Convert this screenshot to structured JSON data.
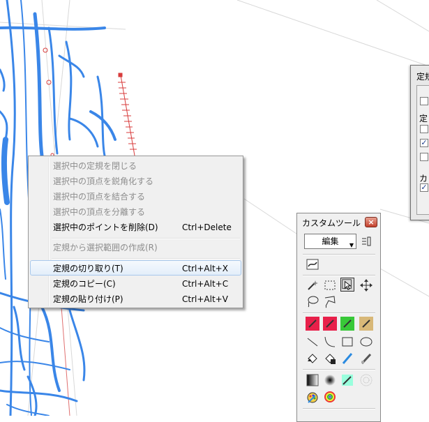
{
  "context_menu": {
    "items": [
      {
        "label": "選択中の定規を閉じる",
        "shortcut": "",
        "enabled": false
      },
      {
        "label": "選択中の頂点を鋭角化する",
        "shortcut": "",
        "enabled": false
      },
      {
        "label": "選択中の頂点を結合する",
        "shortcut": "",
        "enabled": false
      },
      {
        "label": "選択中の頂点を分離する",
        "shortcut": "",
        "enabled": false
      },
      {
        "label": "選択中のポイントを削除(D)",
        "shortcut": "Ctrl+Delete",
        "enabled": true
      },
      {
        "label": "定規から選択範囲の作成(R)",
        "shortcut": "",
        "enabled": false
      },
      {
        "label": "定規の切り取り(T)",
        "shortcut": "Ctrl+Alt+X",
        "enabled": true,
        "hover": true
      },
      {
        "label": "定規のコピー(C)",
        "shortcut": "Ctrl+Alt+C",
        "enabled": true
      },
      {
        "label": "定規の貼り付け(P)",
        "shortcut": "Ctrl+Alt+V",
        "enabled": true
      }
    ]
  },
  "tool_panel": {
    "title": "カスタムツール",
    "close_label": "×",
    "dropdown_value": "編集",
    "tools": [
      {
        "icon": "ruler-edit-icon"
      },
      {
        "icon": "magic-wand-icon"
      },
      {
        "icon": "rect-select-icon"
      },
      {
        "icon": "pointer-select-icon",
        "selected": true
      },
      {
        "icon": "move-icon"
      },
      {
        "icon": "lasso-icon"
      },
      {
        "icon": "polygon-lasso-icon"
      },
      {
        "icon": "pen-red-icon"
      },
      {
        "icon": "pen-magenta-icon"
      },
      {
        "icon": "pen-green-icon"
      },
      {
        "icon": "pen-tan-icon"
      },
      {
        "icon": "line-icon"
      },
      {
        "icon": "curve-icon"
      },
      {
        "icon": "rectangle-icon"
      },
      {
        "icon": "ellipse-icon"
      },
      {
        "icon": "fill-bucket-icon"
      },
      {
        "icon": "fill-selection-icon"
      },
      {
        "icon": "brush-blue-icon"
      },
      {
        "icon": "airbrush-icon"
      },
      {
        "icon": "gradient-icon"
      },
      {
        "icon": "blur-icon"
      },
      {
        "icon": "tone-icon"
      },
      {
        "icon": "pattern-icon"
      },
      {
        "icon": "palette-icon"
      },
      {
        "icon": "rainbow-icon"
      }
    ]
  },
  "dialog": {
    "title": "定規",
    "group1_label": "定",
    "group2_label": "カ",
    "checkboxes": [
      false,
      false,
      true,
      false,
      true
    ]
  },
  "colors": {
    "stroke_blue": "#3a86e8",
    "ruler_red": "#d83c3c",
    "menu_hover_border": "#a8c8ec",
    "disabled_text": "#8d8d8d"
  }
}
